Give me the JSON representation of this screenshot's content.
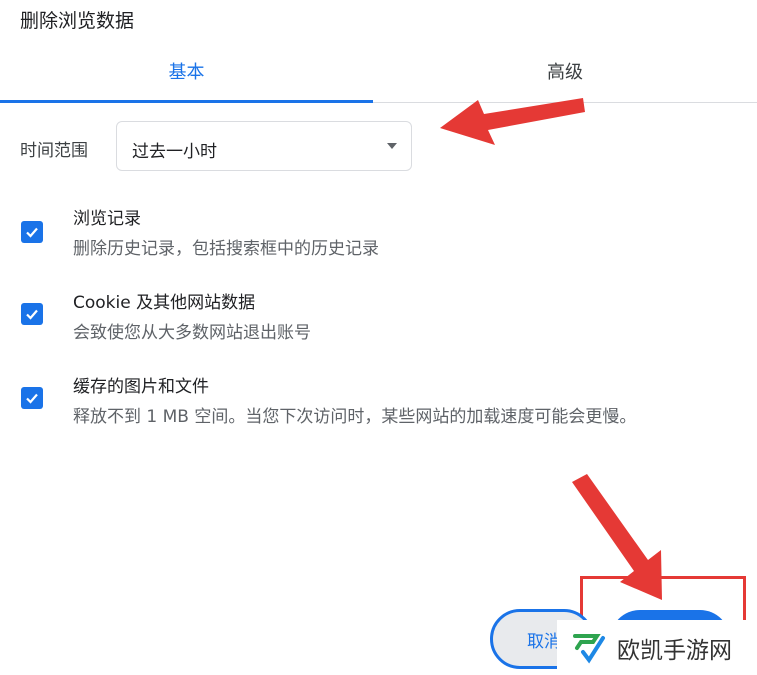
{
  "dialog": {
    "title": "删除浏览数据"
  },
  "tabs": [
    {
      "label": "基本",
      "active": true
    },
    {
      "label": "高级",
      "active": false
    }
  ],
  "time_range": {
    "label": "时间范围",
    "selected": "过去一小时"
  },
  "options": [
    {
      "title": "浏览记录",
      "description": "删除历史记录，包括搜索框中的历史记录",
      "checked": true
    },
    {
      "title": "Cookie 及其他网站数据",
      "description": "会致使您从大多数网站退出账号",
      "checked": true
    },
    {
      "title": "缓存的图片和文件",
      "description": "释放不到 1 MB 空间。当您下次访问时，某些网站的加载速度可能会更慢。",
      "checked": true
    }
  ],
  "buttons": {
    "cancel_label": "取消"
  },
  "watermark": {
    "text": "欧凯手游网"
  },
  "colors": {
    "accent": "#1a73e8",
    "annotation": "#e53935"
  }
}
